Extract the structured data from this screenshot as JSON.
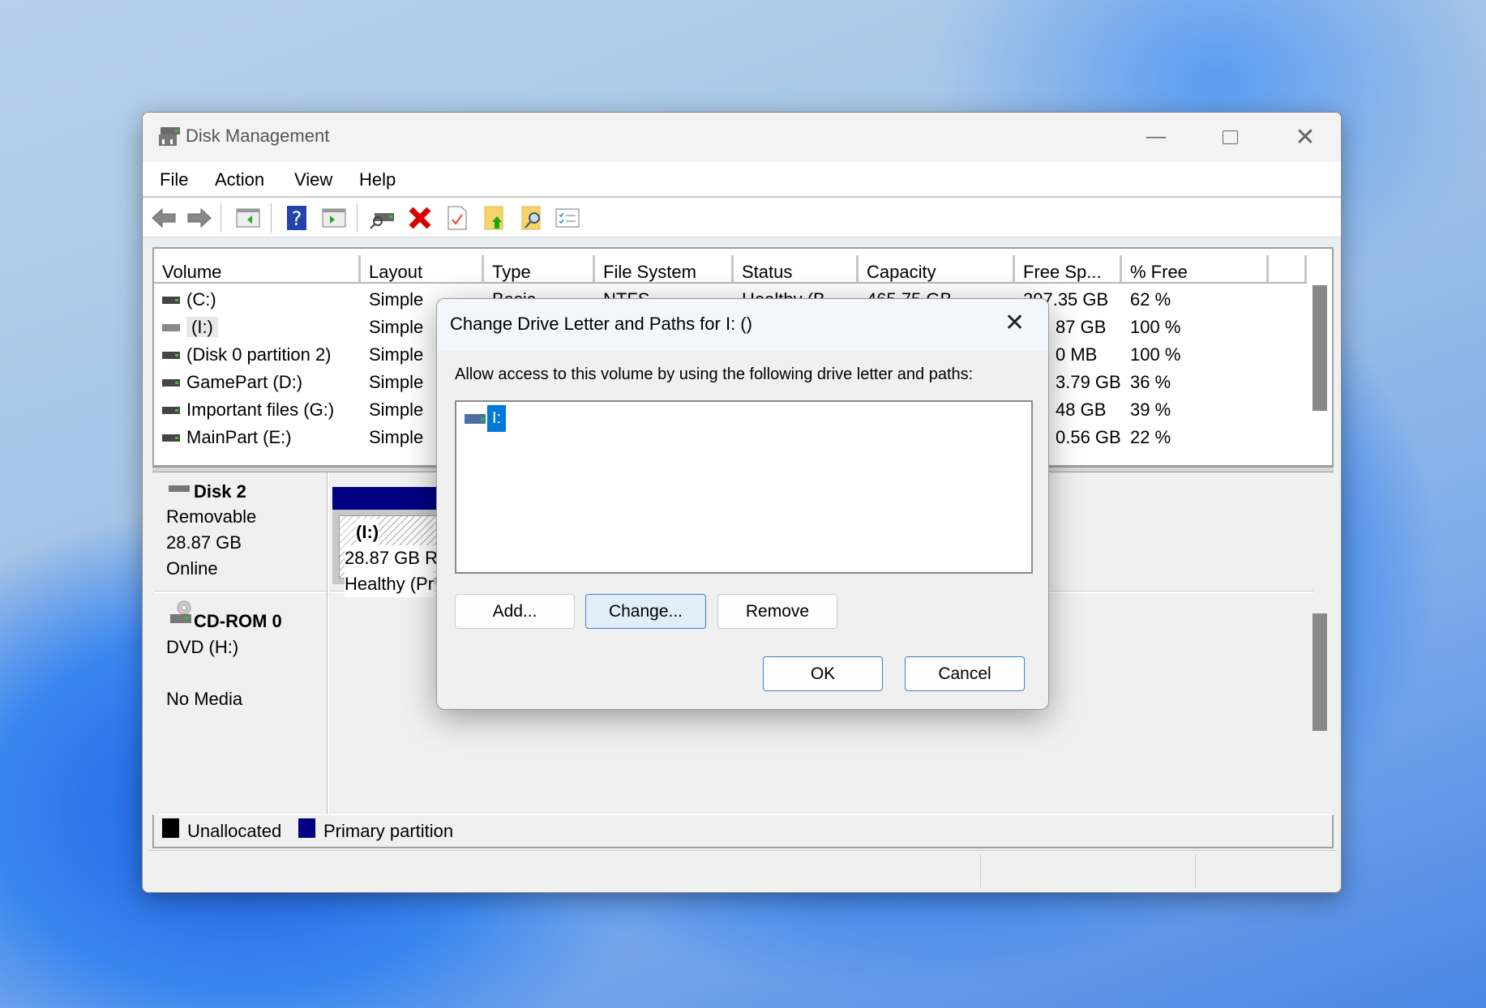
{
  "window": {
    "title": "Disk Management",
    "app_icon": "disk-management-icon"
  },
  "menu": [
    "File",
    "Action",
    "View",
    "Help"
  ],
  "toolbar": [
    "back-icon",
    "forward-icon",
    "show-hide-console-tree-icon",
    "help-icon",
    "show-hide-action-pane-icon",
    "connect-drive-icon",
    "delete-icon",
    "properties-icon",
    "export-list-icon",
    "find-icon",
    "settings-list-icon"
  ],
  "volume_list": {
    "columns": [
      "Volume",
      "Layout",
      "Type",
      "File System",
      "Status",
      "Capacity",
      "Free Sp...",
      "% Free",
      ""
    ],
    "rows": [
      {
        "volume": "(C:)",
        "layout": "Simple",
        "type": "Basic",
        "fs": "NTFS",
        "status": "Healthy (B",
        "capacity": "465.75 GB",
        "free": "297.35 GB",
        "pct": "62 %"
      },
      {
        "volume": "(I:)",
        "layout": "Simple",
        "type": "",
        "fs": "",
        "status": "",
        "capacity": "",
        "free": "87 GB",
        "pct": "100 %"
      },
      {
        "volume": "(Disk 0 partition 2)",
        "layout": "Simple",
        "type": "",
        "fs": "",
        "status": "",
        "capacity": "",
        "free": "0 MB",
        "pct": "100 %"
      },
      {
        "volume": "GamePart (D:)",
        "layout": "Simple",
        "type": "",
        "fs": "",
        "status": "",
        "capacity": "",
        "free": "3.79 GB",
        "pct": "36 %"
      },
      {
        "volume": "Important files (G:)",
        "layout": "Simple",
        "type": "",
        "fs": "",
        "status": "",
        "capacity": "",
        "free": "48 GB",
        "pct": "39 %"
      },
      {
        "volume": "MainPart (E:)",
        "layout": "Simple",
        "type": "",
        "fs": "",
        "status": "",
        "capacity": "",
        "free": "0.56 GB",
        "pct": "22 %"
      }
    ]
  },
  "disks": [
    {
      "name": "Disk 2",
      "line1": "Removable",
      "line2": "28.87 GB",
      "line3": "Online",
      "partition": {
        "label": "(I:)",
        "size": "28.87 GB R",
        "status": "Healthy (Pr"
      }
    },
    {
      "name": "CD-ROM 0",
      "line1": "DVD (H:)",
      "line2": "",
      "line3": "No Media"
    }
  ],
  "legend": [
    {
      "label": "Unallocated",
      "color": "#000000"
    },
    {
      "label": "Primary partition",
      "color": "#000080"
    }
  ],
  "dialog": {
    "title": "Change Drive Letter and Paths for I: ()",
    "prompt": "Allow access to this volume by using the following drive letter and paths:",
    "items": [
      "I:"
    ],
    "buttons": {
      "add": "Add...",
      "change": "Change...",
      "remove": "Remove",
      "ok": "OK",
      "cancel": "Cancel"
    }
  },
  "colors": {
    "selection": "#0078d7",
    "primary_partition": "#000080",
    "button_focus": "#e0eef9"
  }
}
